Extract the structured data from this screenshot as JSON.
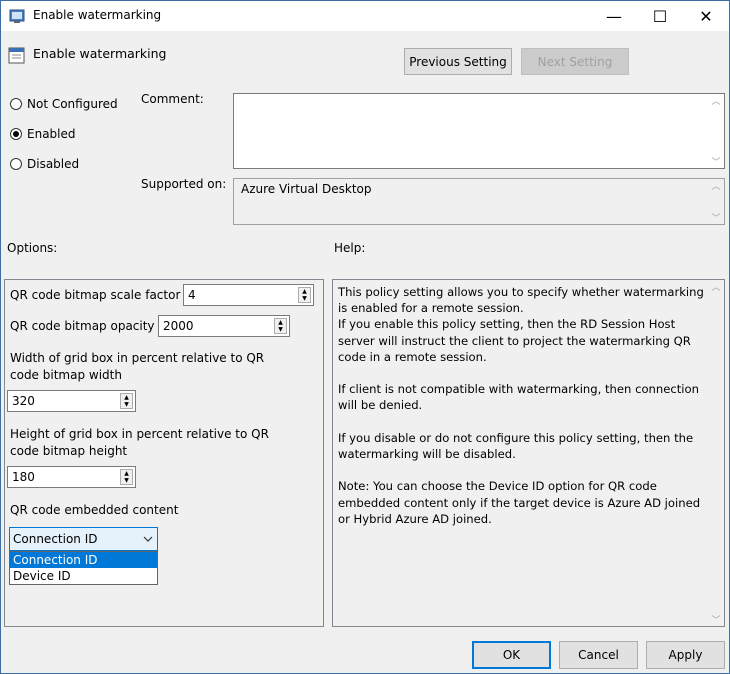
{
  "window": {
    "title": "Enable watermarking",
    "heading": "Enable watermarking",
    "minimize_glyph": "—",
    "maximize_glyph": "☐",
    "close_glyph": "✕"
  },
  "nav": {
    "previous_label": "Previous Setting",
    "next_label": "Next Setting"
  },
  "state": {
    "options": [
      {
        "label": "Not Configured",
        "selected": false
      },
      {
        "label": "Enabled",
        "selected": true
      },
      {
        "label": "Disabled",
        "selected": false
      }
    ]
  },
  "comment": {
    "label": "Comment:",
    "value": ""
  },
  "supported": {
    "label": "Supported on:",
    "value": "Azure Virtual Desktop"
  },
  "options_panel": {
    "header": "Options:",
    "scale_factor": {
      "label": "QR code bitmap scale factor",
      "value": "4"
    },
    "opacity": {
      "label": "QR code bitmap opacity",
      "value": "2000"
    },
    "grid_width": {
      "label": "Width of grid box in percent relative to QR code bitmap width",
      "value": "320"
    },
    "grid_height": {
      "label": "Height of grid box in percent relative to QR code bitmap height",
      "value": "180"
    },
    "embedded": {
      "label": "QR code embedded content",
      "selected": "Connection ID",
      "options": [
        "Connection ID",
        "Device ID"
      ]
    }
  },
  "help": {
    "header": "Help:",
    "text": "This policy setting allows you to specify whether watermarking is enabled for a remote session.\nIf you enable this policy setting, then the RD Session Host server will instruct the client to project the watermarking QR code in a remote session.\n\nIf client is not compatible with watermarking, then connection will be denied.\n\nIf you disable or do not configure this policy setting, then the watermarking will be disabled.\n\nNote: You can choose the Device ID option for QR code embedded content only if the target device is Azure AD joined or Hybrid Azure AD joined."
  },
  "footer": {
    "ok": "OK",
    "cancel": "Cancel",
    "apply": "Apply"
  },
  "colors": {
    "accent": "#0078d7",
    "background": "#f0f0f0"
  }
}
